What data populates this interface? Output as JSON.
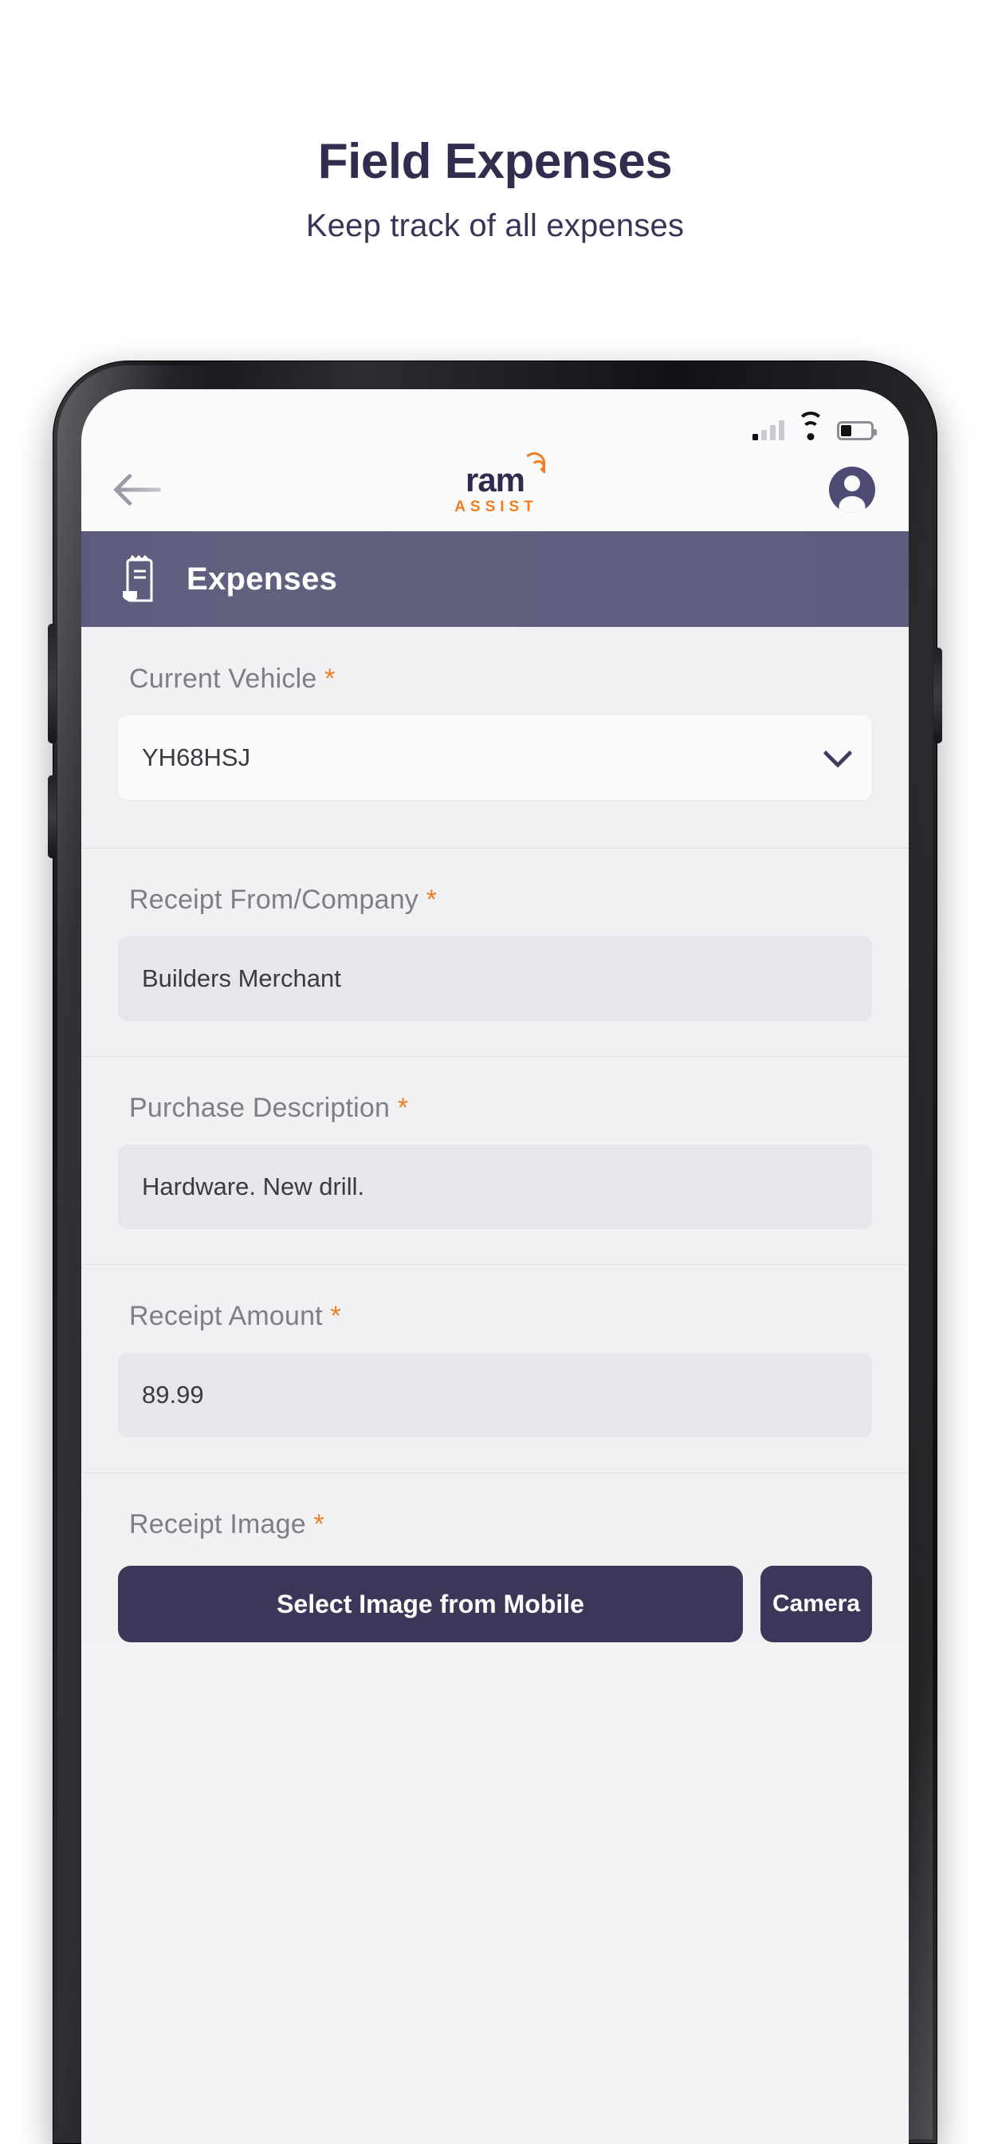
{
  "promo": {
    "title": "Field Expenses",
    "subtitle": "Keep track of all expenses"
  },
  "status_bar": {
    "signal_icon": "signal-bars-icon",
    "wifi_icon": "wifi-icon",
    "battery_icon": "battery-icon"
  },
  "navbar": {
    "back_icon": "back-arrow-icon",
    "logo_word": "ram",
    "logo_tagline": "ASSIST",
    "avatar_icon": "account-avatar-icon"
  },
  "section": {
    "icon": "receipt-icon",
    "title": "Expenses",
    "bg_color": "#5e5d7d"
  },
  "form": {
    "required_mark": "*",
    "fields": [
      {
        "label": "Current Vehicle",
        "required": true,
        "type": "select",
        "value": "YH68HSJ",
        "chevron_icon": "chevron-down-icon"
      },
      {
        "label": "Receipt From/Company",
        "required": true,
        "type": "text",
        "value": "Builders Merchant"
      },
      {
        "label": "Purchase Description",
        "required": true,
        "type": "text",
        "value": "Hardware. New drill."
      },
      {
        "label": "Receipt Amount",
        "required": true,
        "type": "number",
        "value": "89.99"
      },
      {
        "label": "Receipt Image",
        "required": true,
        "type": "file"
      }
    ],
    "buttons": {
      "select_image": "Select Image from Mobile",
      "camera": "Camera"
    }
  },
  "colors": {
    "accent_orange": "#ef7d22",
    "brand_navy": "#2f2a4e",
    "header_purple": "#5e5d7d",
    "button_navy": "#3b3758"
  }
}
